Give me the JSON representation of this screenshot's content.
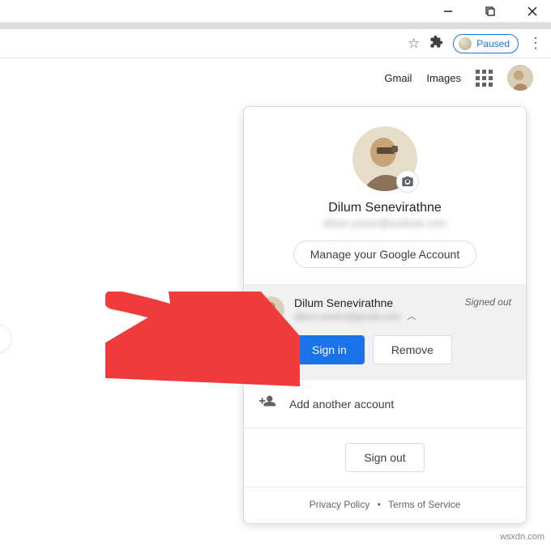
{
  "window": {
    "minimize": "—",
    "maximize": "❐",
    "close": "✕"
  },
  "toolbar": {
    "paused_label": "Paused"
  },
  "header": {
    "gmail": "Gmail",
    "images": "Images"
  },
  "popover": {
    "user_name": "Dilum Senevirathne",
    "user_email": "dilum.senev@outlook.com",
    "manage_label": "Manage your Google Account",
    "account": {
      "name": "Dilum Senevirathne",
      "email": "dilum.senev@gmail.com",
      "status": "Signed out",
      "sign_in": "Sign in",
      "remove": "Remove"
    },
    "add_account": "Add another account",
    "sign_out": "Sign out",
    "privacy": "Privacy Policy",
    "terms": "Terms of Service"
  },
  "watermark": "wsxdn.com"
}
